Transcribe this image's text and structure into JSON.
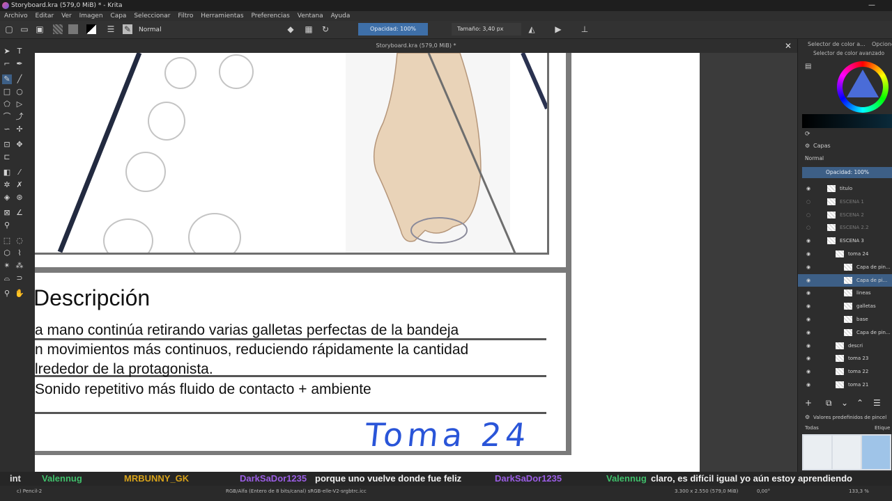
{
  "window": {
    "title": "Storyboard.kra (579,0 MiB) * - Krita",
    "minimize": "—"
  },
  "menu": [
    "Archivo",
    "Editar",
    "Ver",
    "Imagen",
    "Capa",
    "Seleccionar",
    "Filtro",
    "Herramientas",
    "Preferencias",
    "Ventana",
    "Ayuda"
  ],
  "toolbar": {
    "blend_mode": "Normal",
    "opacity": "Opacidad: 100%",
    "size": "Tamaño: 3,40 px"
  },
  "document_tab": {
    "title": "Storyboard.kra (579,0 MiB) *",
    "close": "✕"
  },
  "canvas": {
    "description_title": "Descripción",
    "description_lines": [
      "a mano continúa retirando varias galletas perfectas de la bandeja",
      "n movimientos más continuos, reduciendo rápidamente la cantidad",
      "lrededor de la protagonista.",
      "Sonido repetitivo más fluido de contacto + ambiente"
    ],
    "shot_label": "Toma 24"
  },
  "panels": {
    "color_selector_tab": "Selector de color a...",
    "options_tab": "Opcione",
    "advanced_color_selector": "Selector de color avanzado",
    "layers_title": "Capas",
    "layers_blend": "Normal",
    "layers_opacity": "Opacidad:  100%",
    "layers": [
      {
        "name": "titulo",
        "visible": true,
        "dim": false,
        "selected": false
      },
      {
        "name": "ESCENA 1",
        "visible": false,
        "dim": true,
        "selected": false
      },
      {
        "name": "ESCENA 2",
        "visible": false,
        "dim": true,
        "selected": false
      },
      {
        "name": "ESCENA 2.2",
        "visible": false,
        "dim": true,
        "selected": false
      },
      {
        "name": "ESCENA 3",
        "visible": true,
        "dim": false,
        "selected": false
      },
      {
        "name": "toma 24",
        "visible": true,
        "dim": false,
        "selected": false
      },
      {
        "name": "Capa de pin...",
        "visible": true,
        "dim": false,
        "selected": false
      },
      {
        "name": "Capa de pi...",
        "visible": true,
        "dim": false,
        "selected": true
      },
      {
        "name": "lineas",
        "visible": true,
        "dim": false,
        "selected": false
      },
      {
        "name": "galletas",
        "visible": true,
        "dim": false,
        "selected": false
      },
      {
        "name": "base",
        "visible": true,
        "dim": false,
        "selected": false
      },
      {
        "name": "Capa de pin...",
        "visible": true,
        "dim": false,
        "selected": false
      },
      {
        "name": "descri",
        "visible": true,
        "dim": false,
        "selected": false
      },
      {
        "name": "toma 23",
        "visible": true,
        "dim": false,
        "selected": false
      },
      {
        "name": "toma 22",
        "visible": true,
        "dim": false,
        "selected": false
      },
      {
        "name": "toma 21",
        "visible": true,
        "dim": false,
        "selected": false
      }
    ],
    "brush_presets_title": "Valores predefinidos de pincel",
    "brush_presets_filter": "Todas",
    "brush_presets_tag": "Etique"
  },
  "chat": [
    {
      "text": "int",
      "color": "#e0e0e0"
    },
    {
      "text": "Valennug",
      "color": "#3fbf6a"
    },
    {
      "text": "MRBUNNY_GK",
      "color": "#d7a21a"
    },
    {
      "text": "DarkSaDor1235",
      "color": "#9b5de5"
    },
    {
      "text": "porque uno vuelve donde fue feliz",
      "color": "#f2f2f2"
    },
    {
      "text": "DarkSaDor1235",
      "color": "#9b5de5"
    },
    {
      "text": "Valennug",
      "color": "#3fbf6a"
    },
    {
      "text": "claro, es difícil igual yo aún estoy aprendiendo",
      "color": "#f2f2f2"
    }
  ],
  "statusbar": {
    "brush": "c) Pencil-2",
    "color_space": "RGB/Alfa (Entero de 8 bits/canal)  sRGB-elle-V2-srgbtrc.icc",
    "dimensions": "3.300 x 2.550 (579,0 MiB)",
    "rotation": "0,00°",
    "zoom": "133,3 %"
  }
}
